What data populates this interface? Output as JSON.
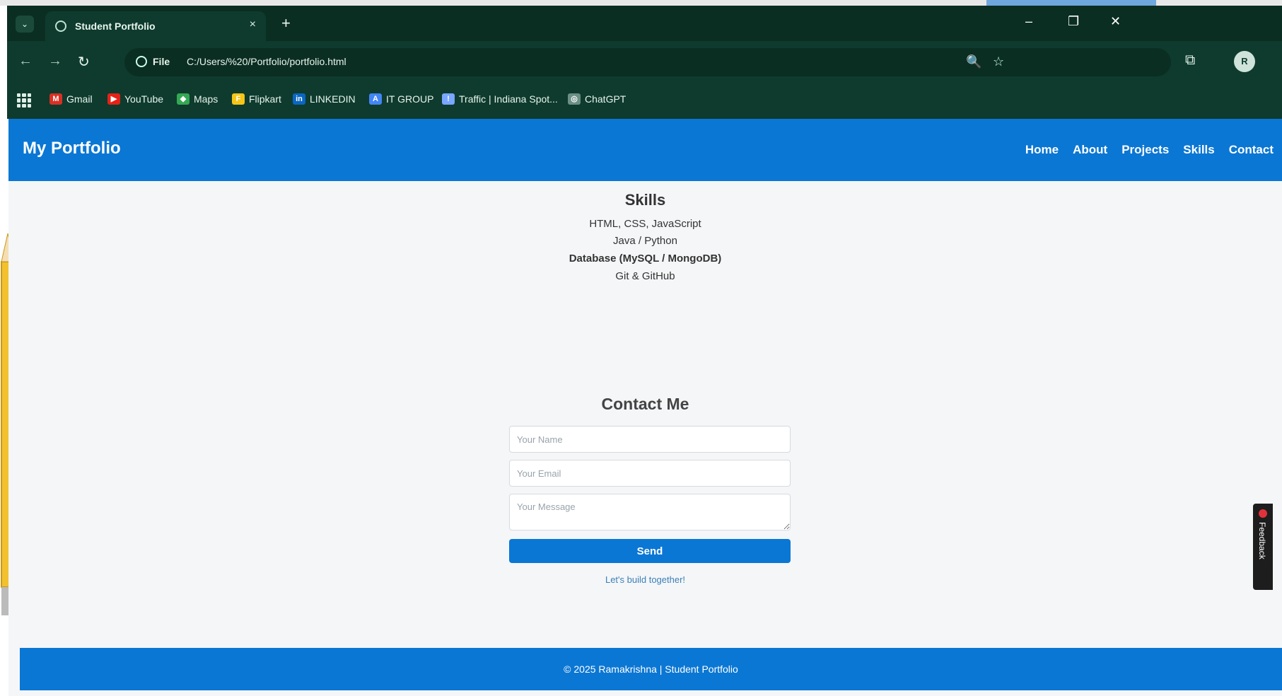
{
  "browser": {
    "tab_title": "Student Portfolio",
    "tab_close": "×",
    "new_tab": "+",
    "tab_dropdown": "⌄",
    "window_controls": {
      "minimize": "–",
      "restore": "❐",
      "close": "✕"
    },
    "nav": {
      "back": "←",
      "forward": "→",
      "reload": "↻"
    },
    "address": {
      "scheme": "File",
      "url": "C:/Users/%20/Portfolio/portfolio.html"
    },
    "omnibox_tools": {
      "zoom": "🔍",
      "star": "☆"
    },
    "extensions_icon": "⧉",
    "profile_initial": "R",
    "bookmarks": [
      {
        "label": "Gmail",
        "icon": "M",
        "color": "#d93025"
      },
      {
        "label": "YouTube",
        "icon": "▶",
        "color": "#e62117"
      },
      {
        "label": "Maps",
        "icon": "◆",
        "color": "#34a853"
      },
      {
        "label": "Flipkart",
        "icon": "F",
        "color": "#f5c518"
      },
      {
        "label": "LINKEDIN",
        "icon": "in",
        "color": "#0a66c2"
      },
      {
        "label": "IT GROUP",
        "icon": "A",
        "color": "#4285f4"
      },
      {
        "label": "Traffic | Indiana Spot...",
        "icon": "!",
        "color": "#7aa7ff"
      },
      {
        "label": "ChatGPT",
        "icon": "◎",
        "color": "#6b8f84"
      }
    ]
  },
  "site": {
    "brand": "My Portfolio",
    "nav_links": [
      "Home",
      "About",
      "Projects",
      "Skills",
      "Contact"
    ]
  },
  "skills": {
    "title": "Skills",
    "items": [
      "HTML, CSS, JavaScript",
      "Java / Python",
      "Database (MySQL / MongoDB)",
      "Git & GitHub"
    ]
  },
  "contact": {
    "title": "Contact Me",
    "name_placeholder": "Your Name",
    "email_placeholder": "Your Email",
    "message_placeholder": "Your Message",
    "send_label": "Send",
    "status": "Let's build together!"
  },
  "footer": {
    "text": "© 2025 Ramakrishna | Student Portfolio"
  },
  "feedback": {
    "label": "Feedback"
  }
}
